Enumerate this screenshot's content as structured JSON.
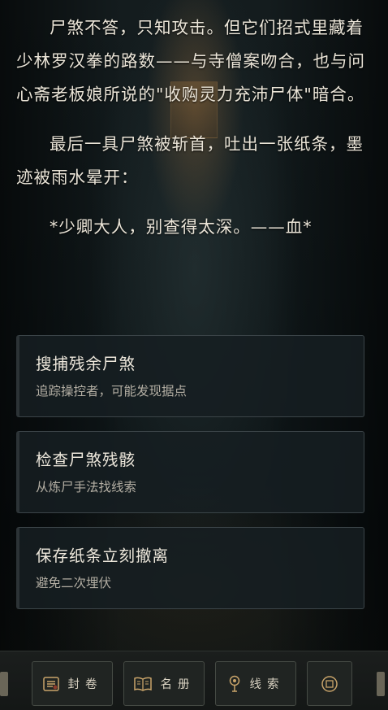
{
  "story": {
    "paragraphs": [
      "尸煞不答，只知攻击。但它们招式里藏着少林罗汉拳的路数——与寺僧案吻合，也与问心斋老板娘所说的\"收购灵力充沛尸体\"暗合。",
      "最后一具尸煞被斩首，吐出一张纸条，墨迹被雨水晕开："
    ],
    "note": "*少卿大人，别查得太深。——血*"
  },
  "choices": [
    {
      "title": "搜捕残余尸煞",
      "desc": "追踪操控者，可能发现据点"
    },
    {
      "title": "检查尸煞残骸",
      "desc": "从炼尸手法找线索"
    },
    {
      "title": "保存纸条立刻撤离",
      "desc": "避免二次埋伏"
    }
  ],
  "nav": {
    "archive_label": "封卷",
    "roster_label": "名册",
    "clues_label": "线索"
  },
  "icons": {
    "archive": "scroll-seal-icon",
    "roster": "book-icon",
    "clues": "lamp-clue-icon",
    "menu": "seal-menu-icon"
  },
  "colors": {
    "accent": "#c9a46a",
    "text": "#ebe5d8",
    "muted": "#b3aea3"
  }
}
